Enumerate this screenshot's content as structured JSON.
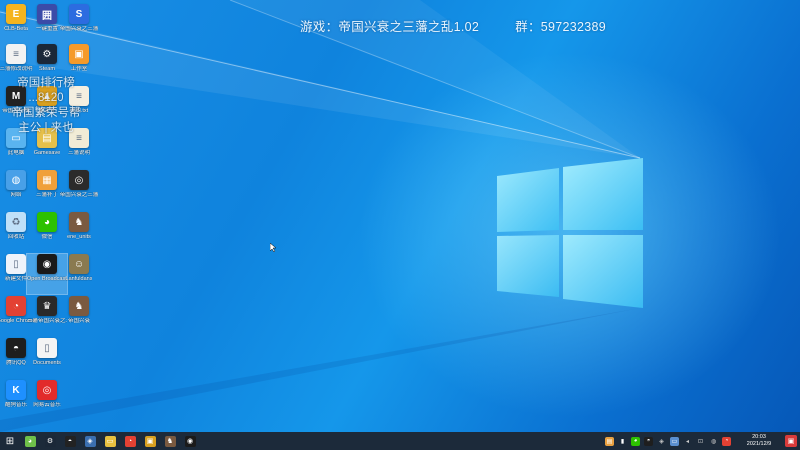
{
  "overlay": {
    "game": "游戏：帝国兴衰之三藩之乱1.02",
    "group": "群：597232389",
    "side_lines": [
      "帝国排行榜",
      "...8120",
      "帝国繁荣号帮",
      "主公 | 来也"
    ]
  },
  "desktop": {
    "icons": [
      {
        "name": "icon-1",
        "label": "CLB-Beta",
        "color": "#f5b41e",
        "glyph": "E"
      },
      {
        "name": "icon-2",
        "label": "一键重置",
        "color": "#3b4ba8",
        "glyph": "囲"
      },
      {
        "name": "icon-3",
        "label": "帝国兴衰之三藩",
        "color": "#2c6ce0",
        "glyph": "S"
      },
      {
        "name": "icon-4",
        "label": "三藩修改说明",
        "color": "#f2f2f2",
        "glyph": "≡"
      },
      {
        "name": "icon-5",
        "label": "Steam",
        "color": "#1b2838",
        "glyph": "⚙"
      },
      {
        "name": "icon-6",
        "label": "工作室",
        "color": "#f59a2a",
        "glyph": "▣"
      },
      {
        "name": "icon-7",
        "label": "帝国排行榜",
        "color": "#222222",
        "glyph": "M"
      },
      {
        "name": "icon-8",
        "label": "繁荣号",
        "color": "#d9a020",
        "glyph": "▲"
      },
      {
        "name": "icon-9",
        "label": "说明.txt",
        "color": "#f4efe0",
        "glyph": "≡"
      },
      {
        "name": "icon-10",
        "label": "此电脑",
        "color": "#5ab4f0",
        "glyph": "▭"
      },
      {
        "name": "icon-11",
        "label": "Gamesave",
        "color": "#e6c04a",
        "glyph": "▤"
      },
      {
        "name": "icon-12",
        "label": "三藩说明",
        "color": "#f1ecd6",
        "glyph": "≡"
      },
      {
        "name": "icon-13",
        "label": "网络",
        "color": "#48a0e8",
        "glyph": "◍"
      },
      {
        "name": "icon-14",
        "label": "三藩补丁",
        "color": "#f0a03a",
        "glyph": "▦"
      },
      {
        "name": "icon-15",
        "label": "帝国兴衰之三藩",
        "color": "#2b2b2b",
        "glyph": "◎"
      },
      {
        "name": "icon-16",
        "label": "回收站",
        "color": "#bfe0f8",
        "glyph": "♻"
      },
      {
        "name": "icon-17",
        "label": "微信",
        "color": "#2dc100",
        "glyph": "◕"
      },
      {
        "name": "icon-18",
        "label": "ene_units",
        "color": "#7a5a40",
        "glyph": "♞"
      },
      {
        "name": "icon-19",
        "label": "新建文件",
        "color": "#eef3fa",
        "glyph": "▯"
      },
      {
        "name": "icon-20",
        "label": "Open Broadcaster Software",
        "color": "#1a1a1a",
        "glyph": "◉"
      },
      {
        "name": "icon-21",
        "label": "Lanfuldans",
        "color": "#8a7a50",
        "glyph": "☺"
      },
      {
        "name": "icon-22",
        "label": "Google Chrome",
        "color": "#e34133",
        "glyph": "◔"
      },
      {
        "name": "icon-23",
        "label": "三藩帝国兴衰之三藩",
        "color": "#2a2a2a",
        "glyph": "♛"
      },
      {
        "name": "icon-24",
        "label": "帝国兴衰",
        "color": "#7a5a40",
        "glyph": "♞"
      },
      {
        "name": "icon-25",
        "label": "腾讯QQ",
        "color": "#1e1e1e",
        "glyph": "◓"
      },
      {
        "name": "icon-26",
        "label": "Documents",
        "color": "#f4f4f4",
        "glyph": "▯"
      },
      {
        "name": "icon-27",
        "label": "酷狗音乐",
        "color": "#1e90ff",
        "glyph": "K"
      },
      {
        "name": "icon-28",
        "label": "网易云音乐",
        "color": "#e22b2b",
        "glyph": "◎"
      }
    ]
  },
  "taskbar": {
    "start": "⊞",
    "apps": [
      {
        "name": "taskbar-app-1",
        "color": "#6fc04a",
        "glyph": "◕"
      },
      {
        "name": "taskbar-app-2",
        "color": "#1b2838",
        "glyph": "⚙"
      },
      {
        "name": "taskbar-app-3",
        "color": "#222",
        "glyph": "◓"
      },
      {
        "name": "taskbar-app-4",
        "color": "#3b6fb0",
        "glyph": "◈"
      },
      {
        "name": "taskbar-app-5",
        "color": "#e8c040",
        "glyph": "▭"
      },
      {
        "name": "taskbar-app-6",
        "color": "#e34133",
        "glyph": "◔"
      },
      {
        "name": "taskbar-app-7",
        "color": "#d9a020",
        "glyph": "▣"
      },
      {
        "name": "taskbar-app-8",
        "color": "#7a5a40",
        "glyph": "♞"
      },
      {
        "name": "taskbar-app-9",
        "color": "#1a1a1a",
        "glyph": "◉"
      }
    ],
    "tray_icons": [
      {
        "name": "tray-app-1",
        "color": "#e8a040",
        "glyph": "▤"
      },
      {
        "name": "tray-app-2",
        "color": "#ffffff",
        "glyph": "▮"
      },
      {
        "name": "tray-app-3",
        "color": "#2dc100",
        "glyph": "◕"
      },
      {
        "name": "tray-app-4",
        "color": "#1e1e1e",
        "glyph": "◓"
      },
      {
        "name": "tray-app-5",
        "color": "#cccccc",
        "glyph": "◈"
      },
      {
        "name": "tray-app-6",
        "color": "#5a8fd0",
        "glyph": "▭"
      },
      {
        "name": "tray-app-7",
        "color": "#cccccc",
        "glyph": "◂"
      },
      {
        "name": "tray-app-8",
        "color": "#cccccc",
        "glyph": "⊡"
      },
      {
        "name": "tray-app-9",
        "color": "#cccccc",
        "glyph": "◍"
      },
      {
        "name": "tray-app-10",
        "color": "#e34133",
        "glyph": "◔"
      }
    ],
    "clock_time": "20:03",
    "clock_date": "2021/12/9"
  }
}
